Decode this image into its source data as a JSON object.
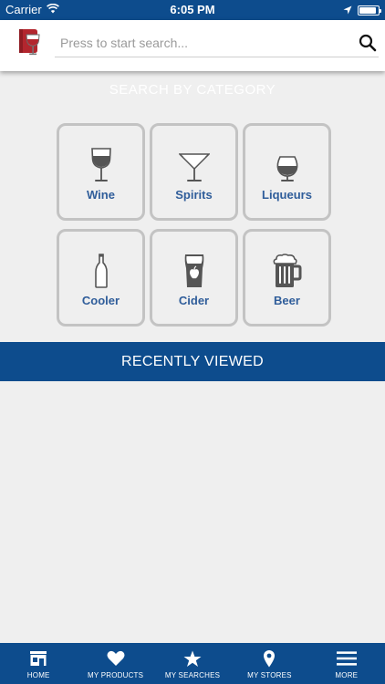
{
  "status_bar": {
    "carrier": "Carrier",
    "time": "6:05 PM",
    "battery_level": 0.9
  },
  "search": {
    "placeholder": "Press to start search..."
  },
  "category_title": "SEARCH BY CATEGORY",
  "categories": [
    {
      "label": "Wine",
      "icon": "wine-glass-icon"
    },
    {
      "label": "Spirits",
      "icon": "martini-glass-icon"
    },
    {
      "label": "Liqueurs",
      "icon": "snifter-glass-icon"
    },
    {
      "label": "Cooler",
      "icon": "bottle-icon"
    },
    {
      "label": "Cider",
      "icon": "cider-glass-icon"
    },
    {
      "label": "Beer",
      "icon": "beer-mug-icon"
    }
  ],
  "recently_viewed": {
    "label": "RECENTLY VIEWED"
  },
  "tabs": [
    {
      "label": "HOME",
      "icon": "store-icon"
    },
    {
      "label": "MY PRODUCTS",
      "icon": "heart-icon"
    },
    {
      "label": "MY SEARCHES",
      "icon": "star-icon"
    },
    {
      "label": "MY STORES",
      "icon": "location-pin-icon"
    },
    {
      "label": "MORE",
      "icon": "menu-icon"
    }
  ],
  "colors": {
    "primary": "#0d4c8d",
    "tile_border": "#c3c3c3",
    "label_blue": "#2f5d9a",
    "background": "#efefef",
    "icon_gray": "#555555"
  }
}
